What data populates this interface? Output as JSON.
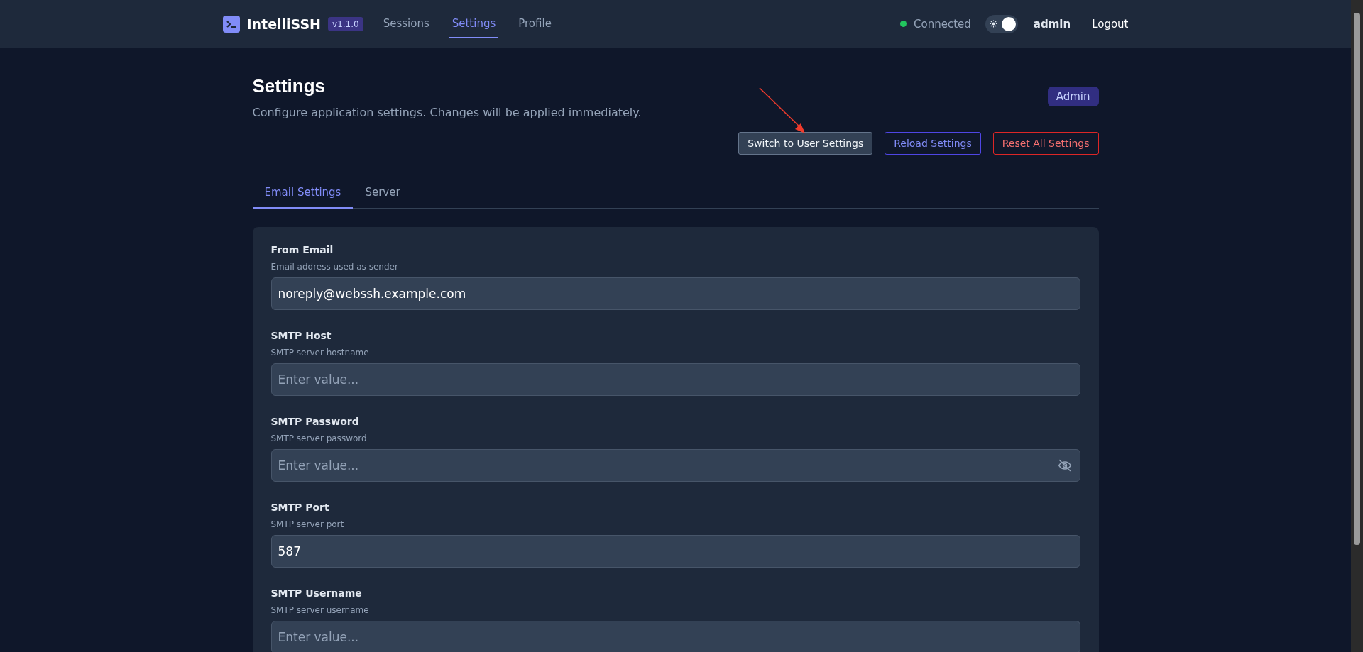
{
  "header": {
    "logo": "IntelliSSH",
    "version": "v1.1.0",
    "nav": [
      {
        "label": "Sessions",
        "selected": false
      },
      {
        "label": "Settings",
        "selected": true
      },
      {
        "label": "Profile",
        "selected": false
      }
    ],
    "status": {
      "label": "Connected",
      "online": true
    },
    "theme_toggle": {
      "on": true
    },
    "user": "admin",
    "logout": "Logout"
  },
  "page": {
    "title": "Settings",
    "subtitle": "Configure application settings. Changes will be applied immediately.",
    "role_badge": "Admin",
    "actions": [
      {
        "label": "Switch to User Settings",
        "kind": "neutral"
      },
      {
        "label": "Reload Settings",
        "kind": "primary"
      },
      {
        "label": "Reset All Settings",
        "kind": "danger"
      }
    ]
  },
  "tabs": [
    {
      "label": "Email Settings",
      "selected": true
    },
    {
      "label": "Server",
      "selected": false
    }
  ],
  "fields": [
    {
      "label": "From Email",
      "hint": "Email address used as sender",
      "value": "noreply@webssh.example.com",
      "kind": "text"
    },
    {
      "label": "SMTP Host",
      "hint": "SMTP server hostname",
      "placeholder": "Enter value...",
      "kind": "text"
    },
    {
      "label": "SMTP Password",
      "hint": "SMTP server password",
      "placeholder": "Enter value...",
      "kind": "password"
    },
    {
      "label": "SMTP Port",
      "hint": "SMTP server port",
      "value": "587",
      "kind": "text"
    },
    {
      "label": "SMTP Username",
      "hint": "SMTP server username",
      "placeholder": "Enter value...",
      "kind": "text"
    }
  ]
}
